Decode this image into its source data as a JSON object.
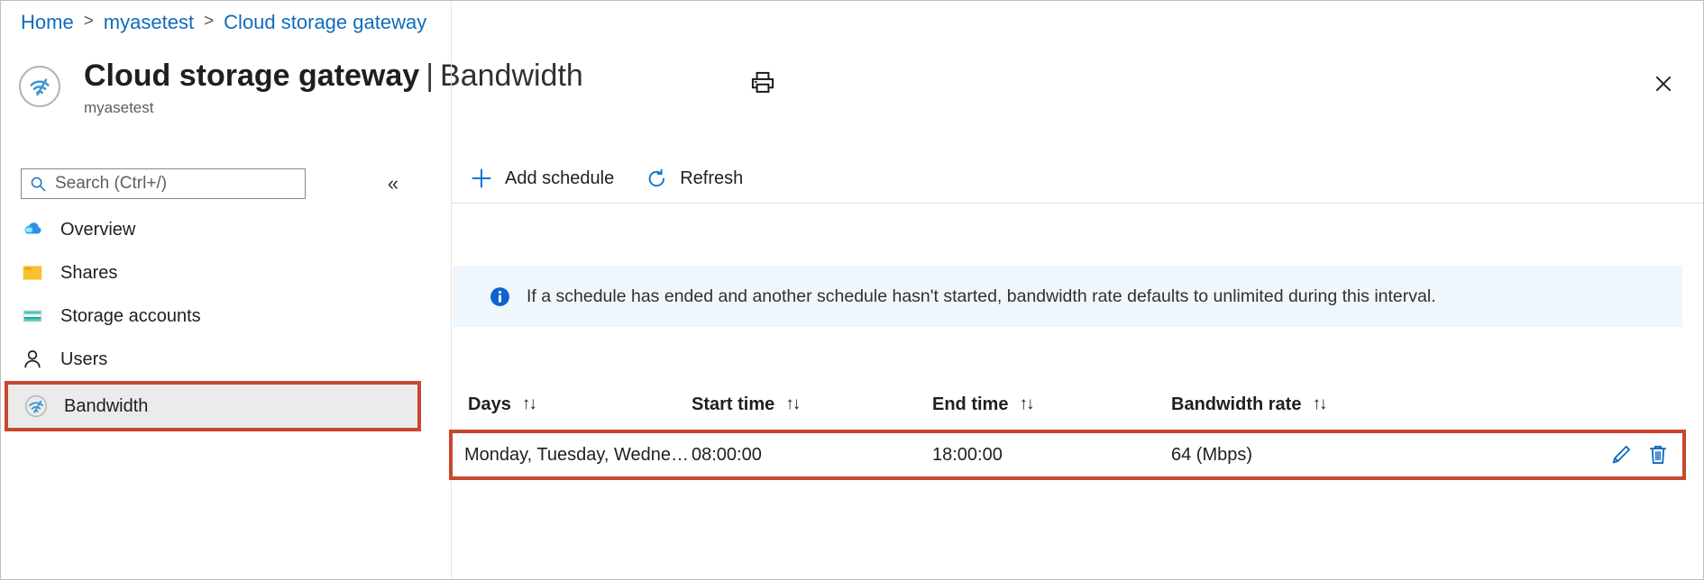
{
  "breadcrumb": {
    "items": [
      {
        "label": "Home"
      },
      {
        "label": "myasetest"
      },
      {
        "label": "Cloud storage gateway"
      }
    ],
    "separator": ">"
  },
  "header": {
    "title_main": "Cloud storage gateway",
    "title_separator": "|",
    "title_section": "Bandwidth",
    "subtitle": "myasetest",
    "resource_icon": "cloud-storage-gateway-icon",
    "print_icon": "print-icon",
    "close_icon": "close-icon"
  },
  "sidebar": {
    "search": {
      "placeholder": "Search (Ctrl+/)",
      "value": "",
      "icon": "search-icon"
    },
    "collapse_icon": "chevron-double-left-icon",
    "items": [
      {
        "label": "Overview",
        "icon": "cloud-icon",
        "selected": false
      },
      {
        "label": "Shares",
        "icon": "folder-icon",
        "selected": false
      },
      {
        "label": "Storage accounts",
        "icon": "storage-account-icon",
        "selected": false
      },
      {
        "label": "Users",
        "icon": "user-icon",
        "selected": false
      },
      {
        "label": "Bandwidth",
        "icon": "bandwidth-icon",
        "selected": true
      }
    ]
  },
  "toolbar": {
    "add_schedule_label": "Add schedule",
    "add_schedule_icon": "plus-icon",
    "refresh_label": "Refresh",
    "refresh_icon": "refresh-icon"
  },
  "banner": {
    "icon": "info-icon",
    "text": "If a schedule has ended and another schedule hasn't started, bandwidth rate defaults to unlimited during this interval."
  },
  "table": {
    "sort_icon": "sort-arrows-icon",
    "columns": [
      {
        "label": "Days"
      },
      {
        "label": "Start time"
      },
      {
        "label": "End time"
      },
      {
        "label": "Bandwidth rate"
      }
    ],
    "rows": [
      {
        "days": "Monday, Tuesday, Wednesd...",
        "start_time": "08:00:00",
        "end_time": "18:00:00",
        "bandwidth_rate": "64 (Mbps)",
        "edit_icon": "pencil-icon",
        "delete_icon": "trash-icon"
      }
    ]
  },
  "colors": {
    "link": "#0f6cbd",
    "accent": "#0078d4",
    "highlight_border": "#c9462f",
    "banner_bg": "#eff6fc",
    "selected_bg": "#ebebeb"
  }
}
